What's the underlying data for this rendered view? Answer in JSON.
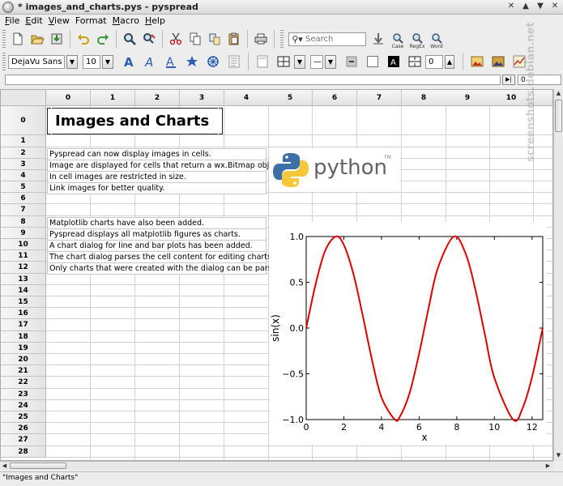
{
  "window": {
    "title": "* images_and_charts.pys - pyspread",
    "controls": [
      "✕",
      "▲",
      "▼",
      "✕"
    ]
  },
  "menu": [
    {
      "underline": "F",
      "rest": "ile"
    },
    {
      "underline": "E",
      "rest": "dit"
    },
    {
      "underline": "V",
      "rest": "iew"
    },
    {
      "underline": "",
      "rest": "Format"
    },
    {
      "underline": "M",
      "rest": "acro"
    },
    {
      "underline": "H",
      "rest": "elp"
    }
  ],
  "toolbar": {
    "search_placeholder": "Search",
    "case_label": "Case",
    "regexp_label": "RegEx",
    "word_label": "Word"
  },
  "format_toolbar": {
    "font": "DejaVu Sans",
    "size": "10",
    "line_width": "0"
  },
  "formula_bar": {
    "value": "",
    "position": "0"
  },
  "columns": [
    "0",
    "1",
    "2",
    "3",
    "4",
    "5",
    "6",
    "7",
    "8",
    "9",
    "10",
    "1"
  ],
  "rows": [
    "0",
    "1",
    "2",
    "3",
    "4",
    "5",
    "6",
    "7",
    "8",
    "9",
    "10",
    "11",
    "12",
    "13",
    "14",
    "15",
    "16",
    "17",
    "18",
    "19",
    "20",
    "21",
    "22",
    "23",
    "24",
    "25",
    "26",
    "27",
    "28"
  ],
  "cells": {
    "title": "Images and Charts",
    "lines": [
      {
        "row": 2,
        "text": "Pyspread can now display images in cells."
      },
      {
        "row": 3,
        "text": "Image are displayed for cells that return a wx.Bitmap object."
      },
      {
        "row": 4,
        "text": "In cell images are restricted in size."
      },
      {
        "row": 5,
        "text": "Link images for better quality."
      },
      {
        "row": 8,
        "text": "Matplotlib charts have also been added."
      },
      {
        "row": 9,
        "text": "Pyspread displays all matplotlib figures as charts."
      },
      {
        "row": 10,
        "text": "A chart dialog for line and bar plots has been added."
      },
      {
        "row": 11,
        "text": "The chart dialog parses the cell content for editing charts."
      },
      {
        "row": 12,
        "text": "Only charts that were created with the dialog can be parsed."
      }
    ]
  },
  "logo": {
    "word": "python",
    "tm": "TM"
  },
  "chart_data": {
    "type": "line",
    "title": "",
    "xlabel": "x",
    "ylabel": "sin(x)",
    "xlim": [
      0,
      12.57
    ],
    "ylim": [
      -1.0,
      1.0
    ],
    "xticks": [
      "0",
      "2",
      "4",
      "6",
      "8",
      "10",
      "12"
    ],
    "yticks": [
      "1.0",
      "0.5",
      "0.0",
      "−0.5",
      "−1.0"
    ],
    "series": [
      {
        "color": "#e00000",
        "x": [
          0,
          0.5,
          1,
          1.5708,
          2,
          2.5,
          3,
          3.5,
          4,
          4.7124,
          5,
          5.5,
          6,
          6.5,
          7,
          7.854,
          8.5,
          9,
          9.5,
          10,
          10.9956,
          11.5,
          12,
          12.57
        ],
        "y": [
          0,
          0.479,
          0.841,
          1.0,
          0.909,
          0.598,
          0.141,
          -0.351,
          -0.757,
          -1.0,
          -0.959,
          -0.706,
          -0.279,
          0.215,
          0.657,
          1.0,
          0.798,
          0.412,
          -0.075,
          -0.544,
          -1.0,
          -0.875,
          -0.537,
          0.0
        ]
      }
    ]
  },
  "statusbar": {
    "text": "\"Images and Charts\""
  },
  "watermark": "screenshots.debian.net"
}
